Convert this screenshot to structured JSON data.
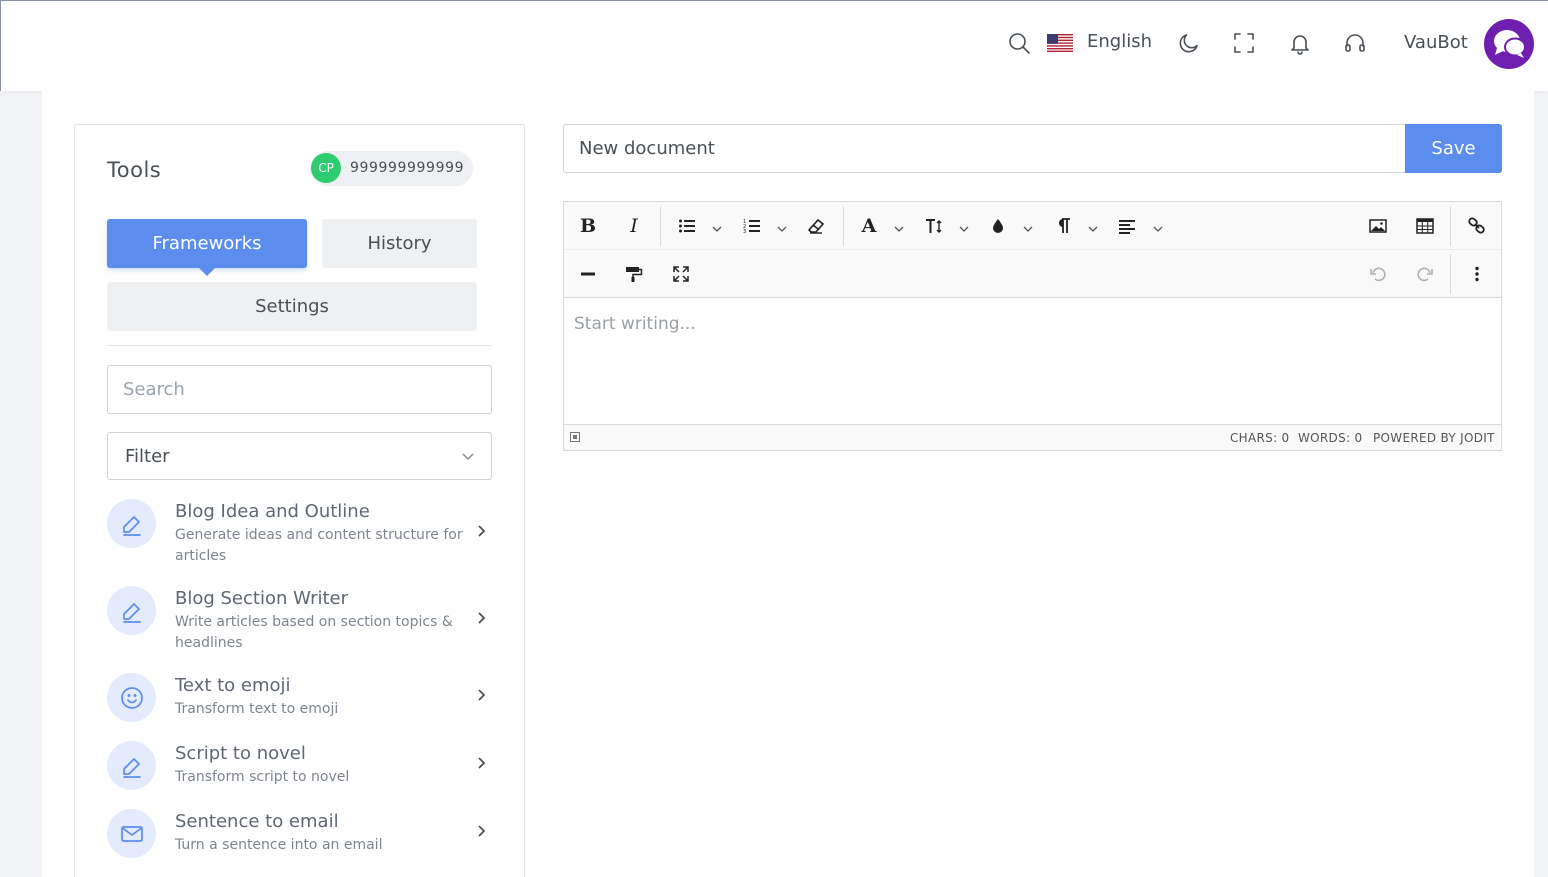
{
  "header": {
    "language_label": "English",
    "user_name": "VauBot",
    "icons": [
      "search-icon",
      "us-flag-icon",
      "moon-icon",
      "fullscreen-icon",
      "bell-icon",
      "headset-icon",
      "chat-bubbles-icon"
    ],
    "colors": {
      "avatar_bg": "#6f1fb0"
    }
  },
  "tools": {
    "title": "Tools",
    "credits_badge": "CP",
    "credits_value": "999999999999",
    "tabs": [
      {
        "label": "Frameworks",
        "active": true
      },
      {
        "label": "History",
        "active": false
      },
      {
        "label": "Settings",
        "active": false
      }
    ],
    "search_placeholder": "Search",
    "filter_label": "Filter",
    "items": [
      {
        "name": "Blog Idea and Outline",
        "desc": "Generate ideas and content structure for articles",
        "icon": "pencil-icon"
      },
      {
        "name": "Blog Section Writer",
        "desc": "Write articles based on section topics & headlines",
        "icon": "pencil-icon"
      },
      {
        "name": "Text to emoji",
        "desc": "Transform text to emoji",
        "icon": "smiley-icon"
      },
      {
        "name": "Script to novel",
        "desc": "Transform script to novel",
        "icon": "pencil-icon"
      },
      {
        "name": "Sentence to email",
        "desc": "Turn a sentence into an email",
        "icon": "envelope-icon"
      }
    ]
  },
  "document": {
    "title_value": "New document",
    "save_label": "Save"
  },
  "editor": {
    "placeholder": "Start writing...",
    "chars": "CHARS: 0",
    "words": "WORDS: 0",
    "powered": "POWERED BY JODIT",
    "bold_label": "B",
    "italic_label": "I",
    "font_label": "A"
  },
  "colors": {
    "primary": "#5b8def",
    "badge_green": "#2ecc71"
  }
}
